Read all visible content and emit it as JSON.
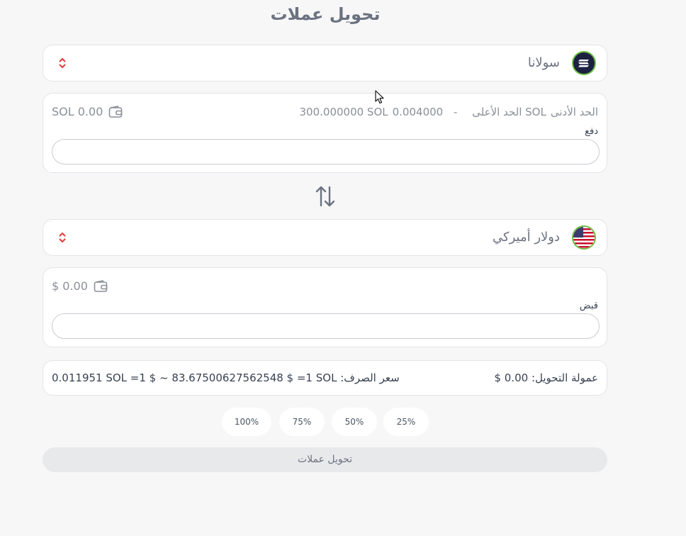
{
  "page_title": "تحويل عملات",
  "from": {
    "currency_name": "سولانا",
    "coin_icon": "solana-icon",
    "min_label": "الحد الأدنى",
    "min_value": "0.004000 SOL",
    "separator": "-",
    "max_label": "الحد الأعلى",
    "max_value": "300.000000 SOL",
    "balance": "SOL 0.00",
    "field_label": "دفع",
    "input_value": ""
  },
  "to": {
    "currency_name": "دولار أميركي",
    "coin_icon": "us-flag-icon",
    "balance": "$ 0.00",
    "field_label": "قبض",
    "input_value": ""
  },
  "info": {
    "fee": "عمولة التحويل: 0.00 $",
    "rate": "0.011951 SOL =1 $ ~ 83.67500627562548 $ =1 SOL :سعر الصرف"
  },
  "percent_buttons": [
    "25%",
    "50%",
    "75%",
    "100%"
  ],
  "convert_button": "تحويل عملات",
  "colors": {
    "accent_red": "#e53935",
    "green_ring": "#6dbe45",
    "solana_bg": "#1c2040"
  }
}
